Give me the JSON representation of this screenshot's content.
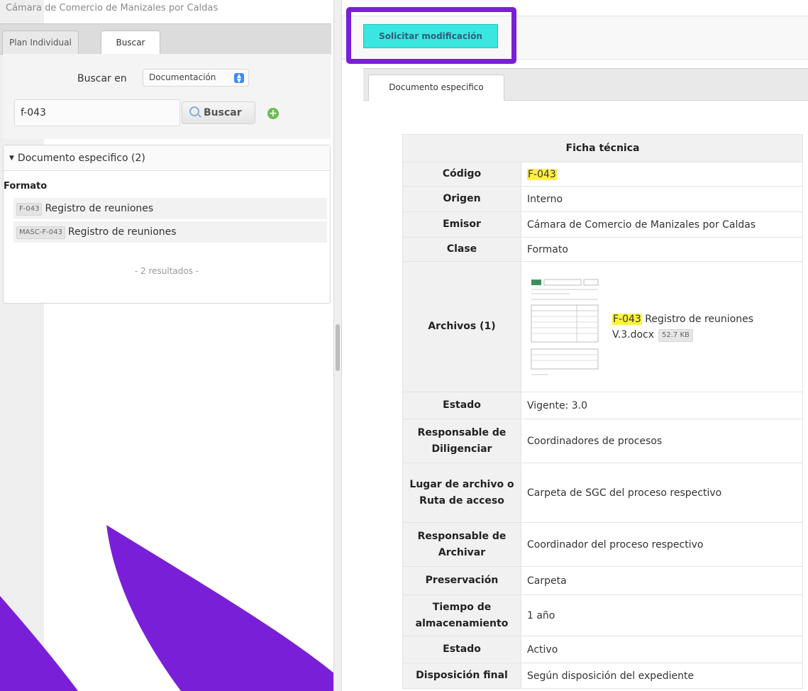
{
  "left": {
    "org_title": "Cámara de Comercio de Manizales por Caldas",
    "tabs": [
      {
        "label": "Plan Individual"
      },
      {
        "label": "Buscar"
      }
    ],
    "search": {
      "buscar_en_label": "Buscar en",
      "scope_value": "Documentación",
      "query_value": "f-043",
      "button_label": "Buscar"
    },
    "results": {
      "group_header": "Documento especifico (2)",
      "category": "Formato",
      "items": [
        {
          "code": "F-043",
          "title": "Registro de reuniones"
        },
        {
          "code": "MASC-F-043",
          "title": "Registro de reuniones"
        }
      ],
      "count_text": "- 2 resultados -"
    }
  },
  "right": {
    "request_button": "Solicitar modificación",
    "doc_tab": "Documento especifico",
    "ficha": {
      "title": "Ficha técnica",
      "codigo_label": "Código",
      "codigo_value": "F-043",
      "origen_label": "Origen",
      "origen_value": "Interno",
      "emisor_label": "Emisor",
      "emisor_value": "Cámara de Comercio de Manizales por Caldas",
      "clase_label": "Clase",
      "clase_value": "Formato",
      "archivos_label": "Archivos (1)",
      "file_code": "F-043",
      "file_name": "Registro de reuniones V.3.docx",
      "file_size": "52.7 KB",
      "estado_label": "Estado",
      "estado_value": "Vigente: 3.0",
      "resp_dilig_label": "Responsable de Diligenciar",
      "resp_dilig_value": "Coordinadores de procesos",
      "lugar_label": "Lugar de archivo o Ruta de acceso",
      "lugar_value": "Carpeta de SGC del proceso respectivo",
      "resp_arch_label": "Responsable de Archivar",
      "resp_arch_value": "Coordinador del proceso respectivo",
      "preserv_label": "Preservación",
      "preserv_value": "Carpeta",
      "tiempo_label": "Tiempo de almacenamiento",
      "tiempo_value": "1 año",
      "estado2_label": "Estado",
      "estado2_value": "Activo",
      "disp_label": "Disposición final",
      "disp_value": "Según disposición del expediente"
    }
  },
  "colors": {
    "accent_purple": "#7a1fd8",
    "button_cyan": "#39e6e0",
    "highlight_yellow": "#fff23d"
  }
}
